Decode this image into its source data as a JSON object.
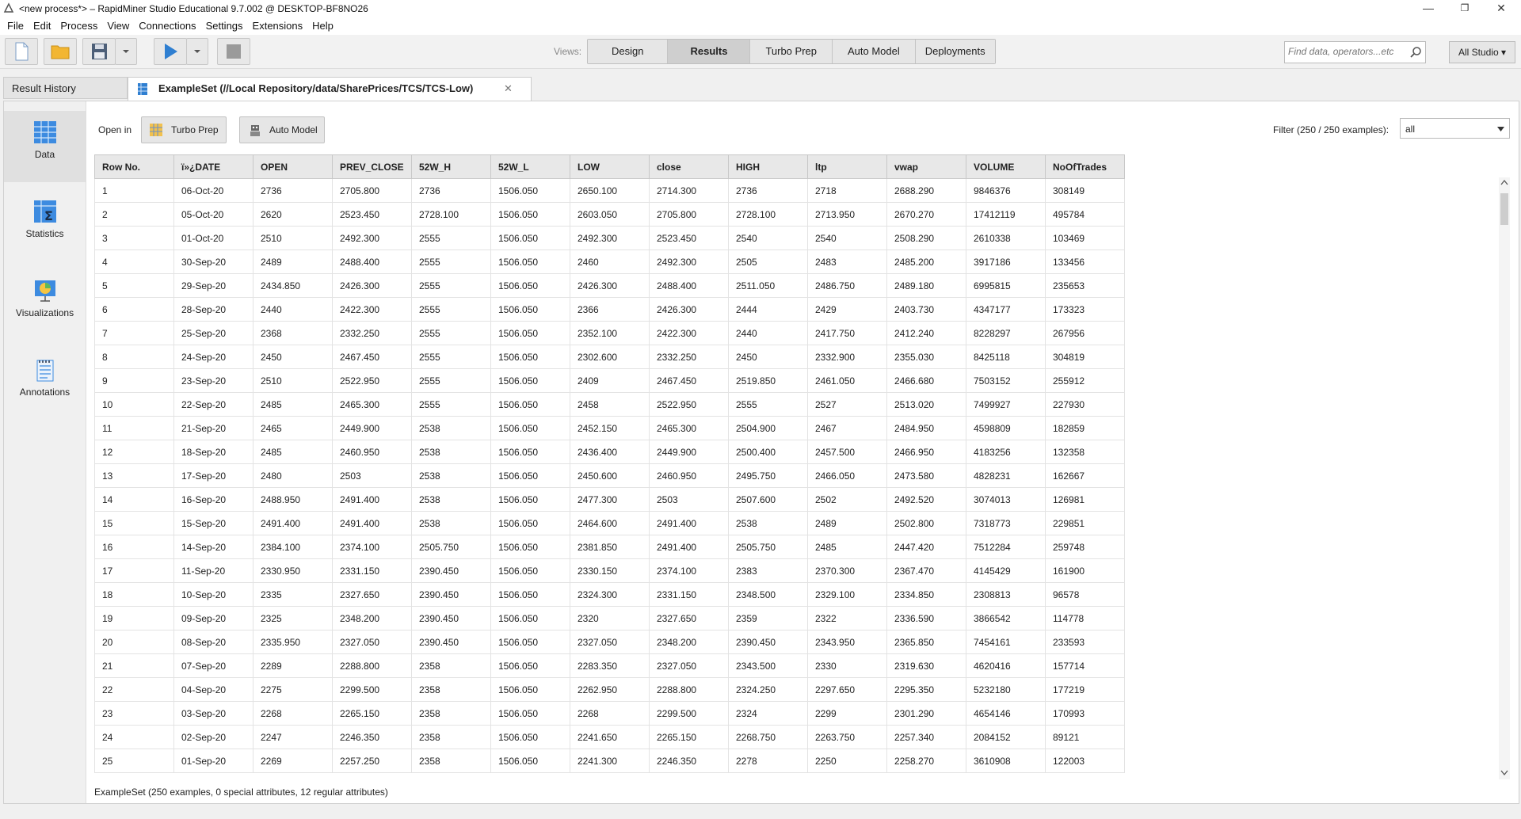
{
  "window": {
    "title": "<new process*> – RapidMiner Studio Educational 9.7.002 @ DESKTOP-BF8NO26",
    "minimize": "—",
    "restore": "❐",
    "close": "✕"
  },
  "menu": [
    "File",
    "Edit",
    "Process",
    "View",
    "Connections",
    "Settings",
    "Extensions",
    "Help"
  ],
  "toolbar": {
    "views_label": "Views:",
    "view_tabs": [
      "Design",
      "Results",
      "Turbo Prep",
      "Auto Model",
      "Deployments"
    ],
    "active_view": "Results",
    "search_placeholder": "Find data, operators...etc",
    "all_studio": "All Studio ▾"
  },
  "tabs": {
    "result_history": "Result History",
    "exampleset": "ExampleSet (//Local Repository/data/SharePrices/TCS/TCS-Low)",
    "close_glyph": "✕"
  },
  "sidebar": [
    {
      "label": "Data",
      "icon": "table-icon"
    },
    {
      "label": "Statistics",
      "icon": "statistics-icon"
    },
    {
      "label": "Visualizations",
      "icon": "visualizations-icon"
    },
    {
      "label": "Annotations",
      "icon": "annotations-icon"
    }
  ],
  "open_in": {
    "label": "Open in",
    "turbo_prep": "Turbo Prep",
    "auto_model": "Auto Model"
  },
  "filter": {
    "label": "Filter (250 / 250 examples):",
    "value": "all"
  },
  "table": {
    "columns": [
      "Row No.",
      "ï»¿DATE",
      "OPEN",
      "PREV_CLOSE",
      "52W_H",
      "52W_L",
      "LOW",
      "close",
      "HIGH",
      "ltp",
      "vwap",
      "VOLUME",
      "NoOfTrades"
    ],
    "rows": [
      [
        "1",
        "06-Oct-20",
        "2736",
        "2705.800",
        "2736",
        "1506.050",
        "2650.100",
        "2714.300",
        "2736",
        "2718",
        "2688.290",
        "9846376",
        "308149"
      ],
      [
        "2",
        "05-Oct-20",
        "2620",
        "2523.450",
        "2728.100",
        "1506.050",
        "2603.050",
        "2705.800",
        "2728.100",
        "2713.950",
        "2670.270",
        "17412119",
        "495784"
      ],
      [
        "3",
        "01-Oct-20",
        "2510",
        "2492.300",
        "2555",
        "1506.050",
        "2492.300",
        "2523.450",
        "2540",
        "2540",
        "2508.290",
        "2610338",
        "103469"
      ],
      [
        "4",
        "30-Sep-20",
        "2489",
        "2488.400",
        "2555",
        "1506.050",
        "2460",
        "2492.300",
        "2505",
        "2483",
        "2485.200",
        "3917186",
        "133456"
      ],
      [
        "5",
        "29-Sep-20",
        "2434.850",
        "2426.300",
        "2555",
        "1506.050",
        "2426.300",
        "2488.400",
        "2511.050",
        "2486.750",
        "2489.180",
        "6995815",
        "235653"
      ],
      [
        "6",
        "28-Sep-20",
        "2440",
        "2422.300",
        "2555",
        "1506.050",
        "2366",
        "2426.300",
        "2444",
        "2429",
        "2403.730",
        "4347177",
        "173323"
      ],
      [
        "7",
        "25-Sep-20",
        "2368",
        "2332.250",
        "2555",
        "1506.050",
        "2352.100",
        "2422.300",
        "2440",
        "2417.750",
        "2412.240",
        "8228297",
        "267956"
      ],
      [
        "8",
        "24-Sep-20",
        "2450",
        "2467.450",
        "2555",
        "1506.050",
        "2302.600",
        "2332.250",
        "2450",
        "2332.900",
        "2355.030",
        "8425118",
        "304819"
      ],
      [
        "9",
        "23-Sep-20",
        "2510",
        "2522.950",
        "2555",
        "1506.050",
        "2409",
        "2467.450",
        "2519.850",
        "2461.050",
        "2466.680",
        "7503152",
        "255912"
      ],
      [
        "10",
        "22-Sep-20",
        "2485",
        "2465.300",
        "2555",
        "1506.050",
        "2458",
        "2522.950",
        "2555",
        "2527",
        "2513.020",
        "7499927",
        "227930"
      ],
      [
        "11",
        "21-Sep-20",
        "2465",
        "2449.900",
        "2538",
        "1506.050",
        "2452.150",
        "2465.300",
        "2504.900",
        "2467",
        "2484.950",
        "4598809",
        "182859"
      ],
      [
        "12",
        "18-Sep-20",
        "2485",
        "2460.950",
        "2538",
        "1506.050",
        "2436.400",
        "2449.900",
        "2500.400",
        "2457.500",
        "2466.950",
        "4183256",
        "132358"
      ],
      [
        "13",
        "17-Sep-20",
        "2480",
        "2503",
        "2538",
        "1506.050",
        "2450.600",
        "2460.950",
        "2495.750",
        "2466.050",
        "2473.580",
        "4828231",
        "162667"
      ],
      [
        "14",
        "16-Sep-20",
        "2488.950",
        "2491.400",
        "2538",
        "1506.050",
        "2477.300",
        "2503",
        "2507.600",
        "2502",
        "2492.520",
        "3074013",
        "126981"
      ],
      [
        "15",
        "15-Sep-20",
        "2491.400",
        "2491.400",
        "2538",
        "1506.050",
        "2464.600",
        "2491.400",
        "2538",
        "2489",
        "2502.800",
        "7318773",
        "229851"
      ],
      [
        "16",
        "14-Sep-20",
        "2384.100",
        "2374.100",
        "2505.750",
        "1506.050",
        "2381.850",
        "2491.400",
        "2505.750",
        "2485",
        "2447.420",
        "7512284",
        "259748"
      ],
      [
        "17",
        "11-Sep-20",
        "2330.950",
        "2331.150",
        "2390.450",
        "1506.050",
        "2330.150",
        "2374.100",
        "2383",
        "2370.300",
        "2367.470",
        "4145429",
        "161900"
      ],
      [
        "18",
        "10-Sep-20",
        "2335",
        "2327.650",
        "2390.450",
        "1506.050",
        "2324.300",
        "2331.150",
        "2348.500",
        "2329.100",
        "2334.850",
        "2308813",
        "96578"
      ],
      [
        "19",
        "09-Sep-20",
        "2325",
        "2348.200",
        "2390.450",
        "1506.050",
        "2320",
        "2327.650",
        "2359",
        "2322",
        "2336.590",
        "3866542",
        "114778"
      ],
      [
        "20",
        "08-Sep-20",
        "2335.950",
        "2327.050",
        "2390.450",
        "1506.050",
        "2327.050",
        "2348.200",
        "2390.450",
        "2343.950",
        "2365.850",
        "7454161",
        "233593"
      ],
      [
        "21",
        "07-Sep-20",
        "2289",
        "2288.800",
        "2358",
        "1506.050",
        "2283.350",
        "2327.050",
        "2343.500",
        "2330",
        "2319.630",
        "4620416",
        "157714"
      ],
      [
        "22",
        "04-Sep-20",
        "2275",
        "2299.500",
        "2358",
        "1506.050",
        "2262.950",
        "2288.800",
        "2324.250",
        "2297.650",
        "2295.350",
        "5232180",
        "177219"
      ],
      [
        "23",
        "03-Sep-20",
        "2268",
        "2265.150",
        "2358",
        "1506.050",
        "2268",
        "2299.500",
        "2324",
        "2299",
        "2301.290",
        "4654146",
        "170993"
      ],
      [
        "24",
        "02-Sep-20",
        "2247",
        "2246.350",
        "2358",
        "1506.050",
        "2241.650",
        "2265.150",
        "2268.750",
        "2263.750",
        "2257.340",
        "2084152",
        "89121"
      ],
      [
        "25",
        "01-Sep-20",
        "2269",
        "2257.250",
        "2358",
        "1506.050",
        "2241.300",
        "2246.350",
        "2278",
        "2250",
        "2258.270",
        "3610908",
        "122003"
      ]
    ]
  },
  "status": "ExampleSet (250 examples, 0 special attributes, 12 regular attributes)"
}
